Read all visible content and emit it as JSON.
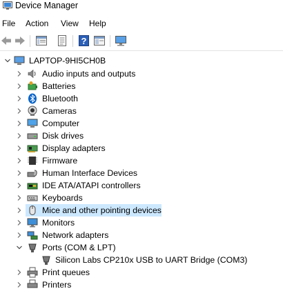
{
  "window": {
    "title": "Device Manager"
  },
  "menu": [
    "File",
    "Action",
    "View",
    "Help"
  ],
  "toolbar": {
    "buttons": [
      "back-icon",
      "forward-icon",
      "properties-icon",
      "update-driver-icon",
      "help-icon",
      "show-hidden-icon",
      "monitor-icon"
    ]
  },
  "tree": {
    "root": "LAPTOP-9HI5CH0B",
    "items": [
      {
        "label": "Audio inputs and outputs",
        "icon": "speaker-icon"
      },
      {
        "label": "Batteries",
        "icon": "battery-icon"
      },
      {
        "label": "Bluetooth",
        "icon": "bluetooth-icon"
      },
      {
        "label": "Cameras",
        "icon": "camera-icon"
      },
      {
        "label": "Computer",
        "icon": "computer-icon"
      },
      {
        "label": "Disk drives",
        "icon": "disk-drive-icon"
      },
      {
        "label": "Display adapters",
        "icon": "display-adapter-icon"
      },
      {
        "label": "Firmware",
        "icon": "firmware-chip-icon"
      },
      {
        "label": "Human Interface Devices",
        "icon": "hid-icon"
      },
      {
        "label": "IDE ATA/ATAPI controllers",
        "icon": "ide-controller-icon"
      },
      {
        "label": "Keyboards",
        "icon": "keyboard-icon"
      },
      {
        "label": "Mice and other pointing devices",
        "icon": "mouse-icon",
        "selected": true
      },
      {
        "label": "Monitors",
        "icon": "monitor-icon"
      },
      {
        "label": "Network adapters",
        "icon": "network-adapter-icon"
      },
      {
        "label": "Ports (COM & LPT)",
        "icon": "port-icon",
        "expanded": true
      },
      {
        "label": "Silicon Labs CP210x USB to UART Bridge (COM3)",
        "icon": "port-icon",
        "child": true
      },
      {
        "label": "Print queues",
        "icon": "printer-icon"
      },
      {
        "label": "Printers",
        "icon": "printer-icon"
      }
    ]
  },
  "colors": {
    "selection": "#cce8ff",
    "accent": "#0078d7"
  }
}
